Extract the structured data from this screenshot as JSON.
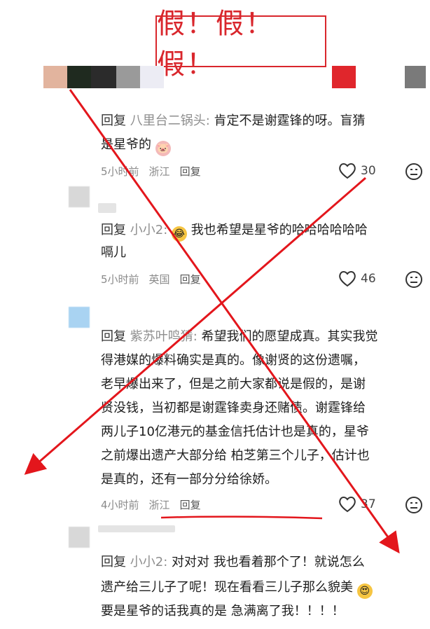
{
  "stamp_text": "假！假！假！",
  "comments": [
    {
      "reply_label": "回复",
      "user": "八里台二锅头",
      "text_lines": [
        "肯定不是谢霆锋的呀。盲猜",
        "是星爷的"
      ],
      "time": "5小时前",
      "location": "浙江",
      "reply_btn": "回复",
      "likes": "30"
    },
    {
      "reply_label": "回复",
      "user": "小小2",
      "text_lines": [
        "我也希望是星爷的哈哈哈哈哈哈",
        "嗝儿"
      ],
      "time": "5小时前",
      "location": "英国",
      "reply_btn": "回复",
      "likes": "46"
    },
    {
      "reply_label": "回复",
      "user": "紫苏叶鸣猜",
      "text_lines": [
        "希望我们的愿望成真。其实我觉",
        "得港媒的爆料确实是真的。像谢贤的这份遗嘱，",
        "老早爆出来了，但是之前大家都说是假的，是谢",
        "贤没钱，当初都是谢霆锋卖身还赌债。谢霆锋给",
        "两儿子10亿港元的基金信托估计也是真的，星爷",
        "之前爆出遗产大部分给 柏芝第三个儿子，估计也",
        "是真的，还有一部分分给徐娇。"
      ],
      "time": "4小时前",
      "location": "浙江",
      "reply_btn": "回复",
      "likes": "37"
    },
    {
      "reply_label": "回复",
      "user": "小小2",
      "text_lines": [
        "对对对 我也看着那个了！就说怎么",
        "遗产给三儿子了呢！现在看看三儿子那么貌美",
        "要是星爷的话我真的是 急满离了我！！！！"
      ]
    }
  ],
  "colors": {
    "stamp": "#d9262c",
    "cross": "#e3161c"
  }
}
